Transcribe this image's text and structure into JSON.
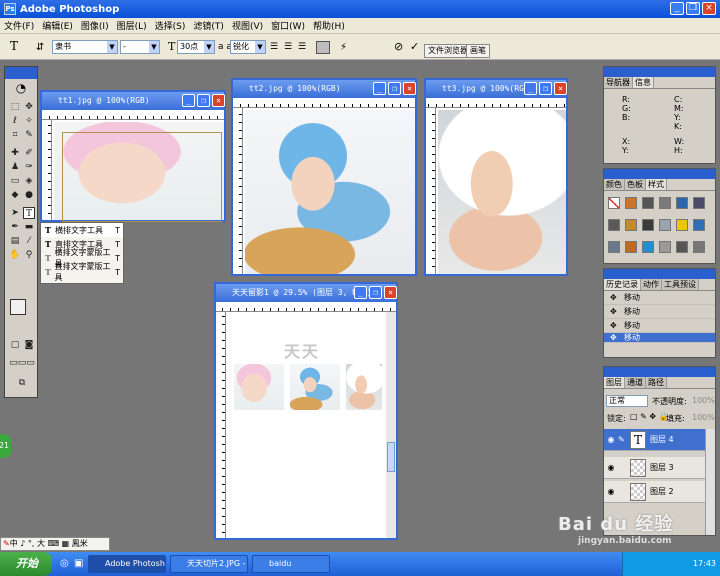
{
  "app": {
    "title": "Adobe Photoshop"
  },
  "menu": [
    "文件(F)",
    "编辑(E)",
    "图像(I)",
    "图层(L)",
    "选择(S)",
    "滤镜(T)",
    "视图(V)",
    "窗口(W)",
    "帮助(H)"
  ],
  "options": {
    "tool_letter": "T",
    "font_family": "隶书",
    "font_style": "-",
    "font_size": "30点",
    "antialias_label": "a a",
    "antialias": "锐化",
    "cancel_glyph": "⊘",
    "commit_glyph": "✓",
    "file_browser": "文件浏览器",
    "brushes": "画笔"
  },
  "flyout": {
    "items": [
      {
        "label": "横排文字工具",
        "shortcut": "T"
      },
      {
        "label": "直排文字工具",
        "shortcut": "T"
      },
      {
        "label": "横排文字蒙版工具",
        "shortcut": "T"
      },
      {
        "label": "直排文字蒙版工具",
        "shortcut": "T"
      }
    ]
  },
  "docs": {
    "tt1": "tt1.jpg @ 100%(RGB)",
    "tt2": "tt2.jpg @ 100%(RGB)",
    "tt3": "tt3.jpg @ 100%(RGB)",
    "main": "天天留影1 @ 29.5% (图层 3, RGB)",
    "main_caption": "天天"
  },
  "panels": {
    "navigator": {
      "tabs": [
        "导航器",
        "信息"
      ],
      "rgb": [
        "R:",
        "G:",
        "B:"
      ],
      "cmyk": [
        "C:",
        "M:",
        "Y:",
        "K:"
      ],
      "xy": [
        "X:",
        "Y:"
      ],
      "wh": [
        "W:",
        "H:"
      ]
    },
    "color": {
      "tabs": [
        "颜色",
        "色板",
        "样式"
      ]
    },
    "history": {
      "tabs": [
        "历史记录",
        "动作",
        "工具预设"
      ],
      "rows": [
        "移动",
        "移动",
        "移动",
        "移动"
      ]
    },
    "layers": {
      "tabs": [
        "图层",
        "通道",
        "路径"
      ],
      "blend_mode": "正常",
      "opacity_label": "不透明度:",
      "opacity": "100%",
      "lock_label": "锁定:",
      "fill_label": "填充:",
      "fill": "100%",
      "rows": [
        "图层 4",
        "图层 3",
        "图层 2"
      ]
    }
  },
  "ime": {
    "text": "中 ♪ °, 大 ⌨ ▦ 鳳米"
  },
  "taskbar": {
    "start": "开始",
    "tasks": [
      "Adobe Photoshop",
      "天天切片2.JPG - ...",
      "baidu"
    ],
    "time": "17:43"
  },
  "watermark": {
    "brand": "Bai du 经验",
    "url": "jingyan.baidu.com"
  },
  "status_badge": "21",
  "colors": {
    "title_blue": "#0a4fd6",
    "panel_bg": "#d4d0c8",
    "desktop": "#767676",
    "start_green": "#2c8a2c"
  }
}
